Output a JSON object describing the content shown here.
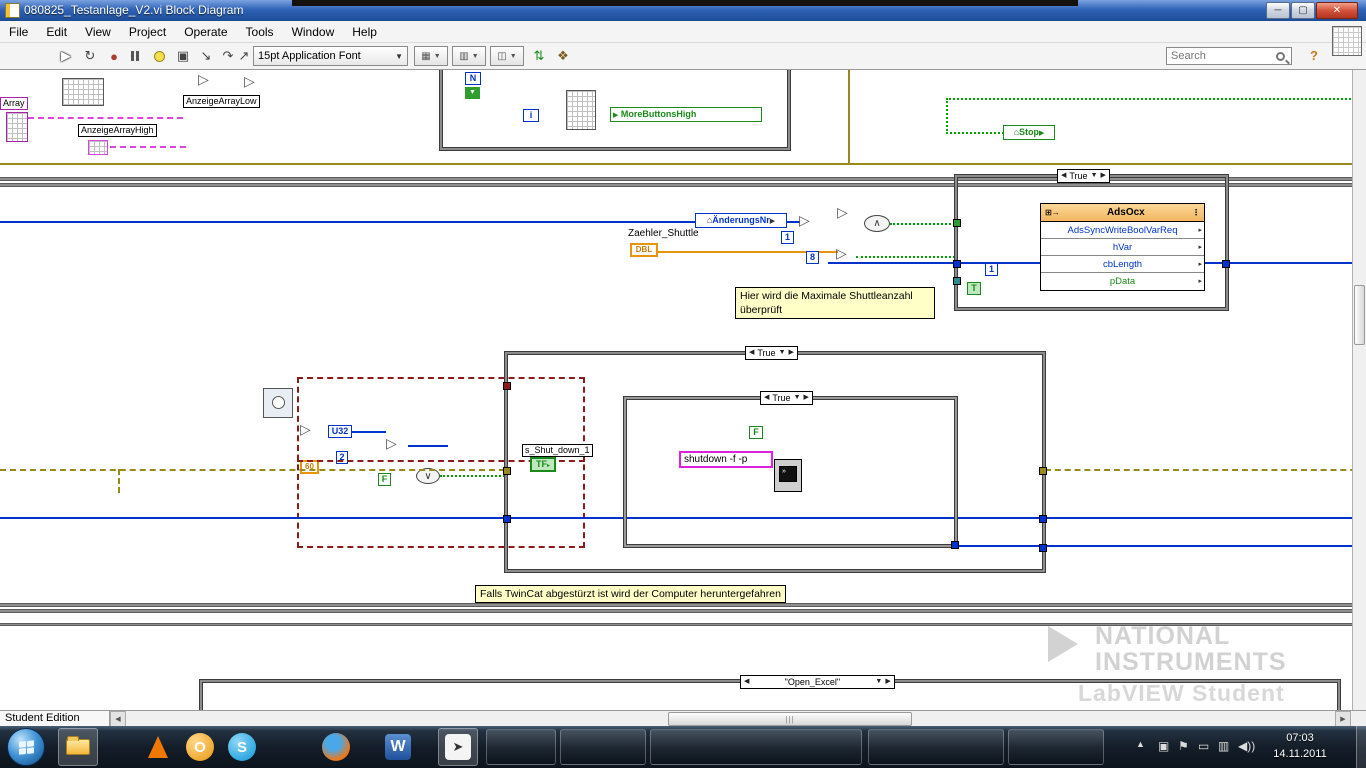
{
  "window": {
    "title": "080825_Testanlage_V2.vi Block Diagram"
  },
  "menu": {
    "items": [
      "File",
      "Edit",
      "View",
      "Project",
      "Operate",
      "Tools",
      "Window",
      "Help"
    ]
  },
  "toolbar": {
    "font_selector": "15pt Application Font",
    "search_placeholder": "Search"
  },
  "diagram": {
    "top": {
      "array_label": "Array",
      "anzeige_array_low": "AnzeigeArrayLow",
      "anzeige_array_high": "AnzeigeArrayHigh",
      "loop_n": "N",
      "loop_i": "i",
      "more_buttons_high": "MoreButtonsHigh",
      "stop": "Stop"
    },
    "mid": {
      "case_selector": "True",
      "aenderungs_nr": "ÄnderungsNr",
      "zaehler_shuttle": "Zaehler_Shuttle",
      "dbl": "DBL",
      "const_1a": "1",
      "const_8": "8",
      "const_1b": "1",
      "const_t": "T",
      "invoke": {
        "title": "AdsOcx",
        "rows": [
          "AdsSyncWriteBoolVarReq",
          "hVar",
          "cbLength",
          "pData"
        ]
      },
      "comment": "Hier wird die Maximale Shuttleanzahl überprüft"
    },
    "lower": {
      "case_outer_selector": "True",
      "case_inner_selector": "True",
      "const_f_inner": "F",
      "shutdown_cmd": "shutdown -f -p",
      "shut_down_label": "s_Shut_down_1",
      "tf": "TF",
      "u32": "U32",
      "const_60": "60",
      "const_2": "2",
      "const_f": "F",
      "comment": "Falls TwinCat abgestürzt ist wird der Computer heruntergefahren"
    },
    "bottom": {
      "case_selector": "\"Open_Excel\""
    },
    "watermark": {
      "line1": "NATIONAL",
      "line2": "INSTRUMENTS",
      "line3": "LabVIEW  Student Edition"
    }
  },
  "statusbar": {
    "edition": "Student Edition"
  },
  "taskbar": {
    "time": "07:03",
    "date": "14.11.2011"
  },
  "colors": {
    "wire_blue": "#0033cc",
    "wire_orange": "#e8950e",
    "wire_green": "#00a000",
    "wire_pink": "#dd44dd",
    "wire_dark_red": "#8b1a1a",
    "comment_bg": "#ffffc8",
    "titlebar_blue": "#2f63b8"
  }
}
